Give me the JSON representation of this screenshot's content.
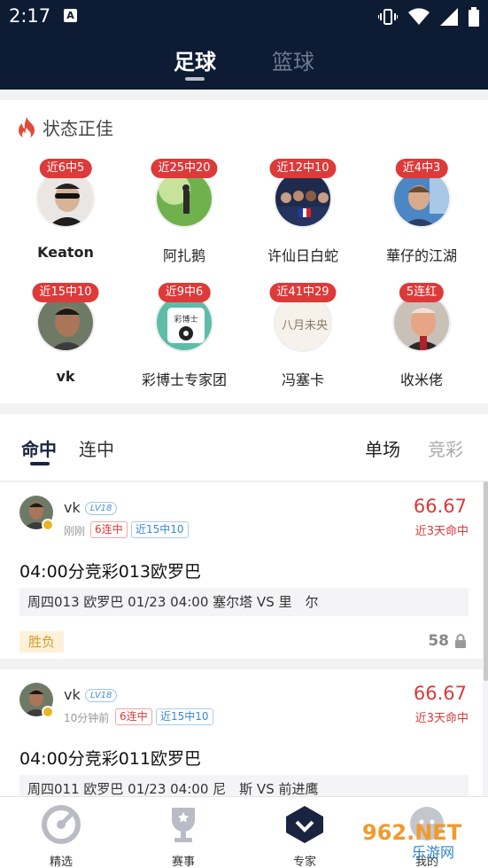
{
  "status_bar": {
    "time": "2:17",
    "notification": "A"
  },
  "header": {
    "tabs": [
      {
        "label": "足球"
      },
      {
        "label": "篮球"
      }
    ]
  },
  "hot_section": {
    "title": "状态正佳",
    "experts": [
      {
        "badge": "近6中5",
        "name": "Keaton"
      },
      {
        "badge": "近25中20",
        "name": "阿扎鹅"
      },
      {
        "badge": "近12中10",
        "name": "许仙日白蛇"
      },
      {
        "badge": "近4中3",
        "name": "華仔的江湖"
      },
      {
        "badge": "近15中10",
        "name": "vk"
      },
      {
        "badge": "近9中6",
        "name": "彩博士专家团"
      },
      {
        "badge": "近41中29",
        "name": "冯塞卡"
      },
      {
        "badge": "5连红",
        "name": "收米佬"
      }
    ],
    "avatar_texts": {
      "caiboshi": "彩博士",
      "fengsaika": "八月未央"
    }
  },
  "list_tabs": {
    "left": [
      {
        "label": "命中"
      },
      {
        "label": "连中"
      }
    ],
    "right": [
      {
        "label": "单场"
      },
      {
        "label": "竞彩"
      }
    ]
  },
  "cards": [
    {
      "name": "vk",
      "level": "LV18",
      "time": "刚刚",
      "tags": [
        "6连中",
        "近15中10"
      ],
      "rate": "66.67",
      "rate_label": "近3天命中",
      "title": "04:00分竞彩013欧罗巴",
      "match": "周四013 欧罗巴 01/23 04:00 塞尔塔 VS 里　尔",
      "play_type": "胜负",
      "price": "58"
    },
    {
      "name": "vk",
      "level": "LV18",
      "time": "10分钟前",
      "tags": [
        "6连中",
        "近15中10"
      ],
      "rate": "66.67",
      "rate_label": "近3天命中",
      "title": "04:00分竞彩011欧罗巴",
      "match": "周四011 欧罗巴 01/23 04:00 尼　斯 VS 前进鹰"
    }
  ],
  "bottom_nav": [
    {
      "label": "精选"
    },
    {
      "label": "赛事"
    },
    {
      "label": "专家"
    },
    {
      "label": "我的"
    }
  ],
  "watermark": {
    "text": "962.NET",
    "subtext": "乐游网"
  },
  "colors": {
    "header_bg": "#0d1b33",
    "badge_red": "#dd3a3a",
    "rate_red": "#d93a3a",
    "accent_navy": "#1a2440"
  }
}
